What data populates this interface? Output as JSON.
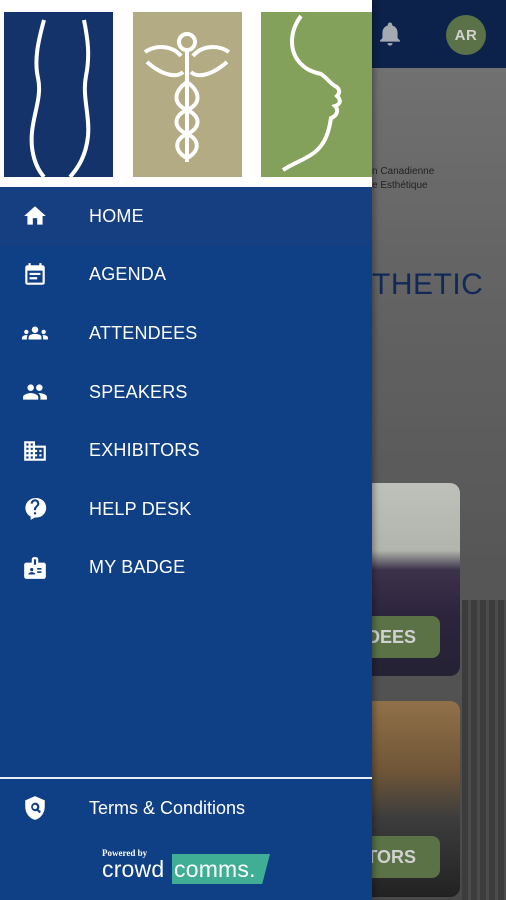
{
  "background": {
    "avatar_initials": "AR",
    "org_line1": "n Canadienne",
    "org_line2": "e Esthétique",
    "heading_fragment": "THETIC",
    "card1_button": "DEES",
    "card2_button": "TORS"
  },
  "drawer": {
    "logos": [
      "body-silhouette-logo",
      "caduceus-logo",
      "face-profile-logo"
    ],
    "menu": [
      {
        "label": "HOME",
        "icon": "home-icon",
        "active": true
      },
      {
        "label": "AGENDA",
        "icon": "agenda-icon",
        "active": false
      },
      {
        "label": "ATTENDEES",
        "icon": "attendees-icon",
        "active": false
      },
      {
        "label": "SPEAKERS",
        "icon": "speakers-icon",
        "active": false
      },
      {
        "label": "EXHIBITORS",
        "icon": "exhibitors-icon",
        "active": false
      },
      {
        "label": "HELP DESK",
        "icon": "help-desk-icon",
        "active": false
      },
      {
        "label": "MY BADGE",
        "icon": "badge-icon",
        "active": false
      }
    ],
    "terms_label": "Terms & Conditions",
    "powered_by": "Powered by",
    "brand_part1": "crowd",
    "brand_part2": "comms",
    "brand_dot": "."
  },
  "colors": {
    "drawer_bg": "#0f3f85",
    "active_item_bg": "#163f82",
    "topbar": "#0f2a5c",
    "accent_green": "#6e8b55",
    "brand_teal": "#3fae95"
  }
}
